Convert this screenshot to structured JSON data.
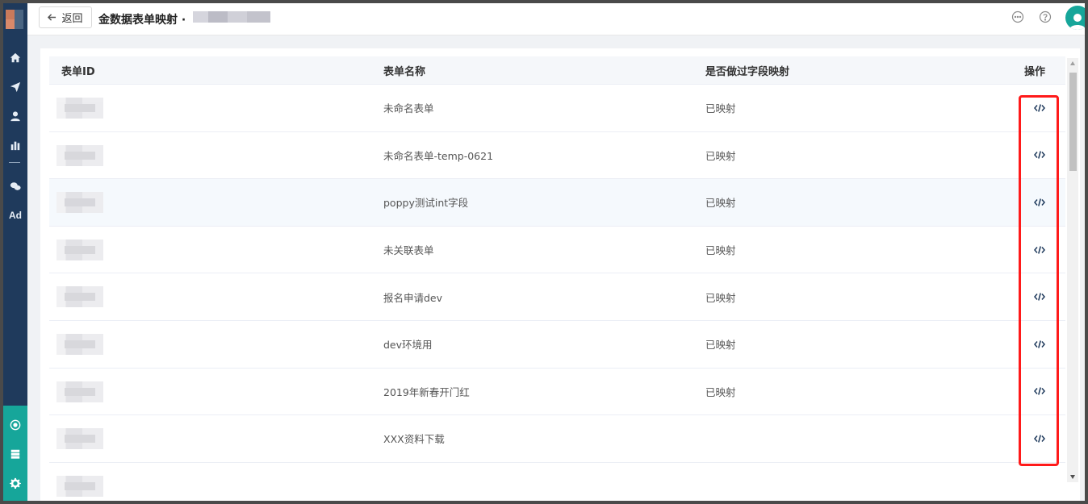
{
  "header": {
    "back_label": "返回",
    "title": "金数据表单映射 ·"
  },
  "table": {
    "columns": [
      "表单ID",
      "表单名称",
      "是否做过字段映射",
      "操作"
    ],
    "rows": [
      {
        "name": "未命名表单",
        "mapped": "已映射"
      },
      {
        "name": "未命名表单-temp-0621",
        "mapped": "已映射"
      },
      {
        "name": "poppy测试int字段",
        "mapped": "已映射"
      },
      {
        "name": "未关联表单",
        "mapped": "已映射"
      },
      {
        "name": "报名申请dev",
        "mapped": "已映射"
      },
      {
        "name": "dev环境用",
        "mapped": "已映射"
      },
      {
        "name": "2019年新春开门红",
        "mapped": "已映射"
      },
      {
        "name": "XXX资料下载",
        "mapped": ""
      }
    ]
  },
  "sidebar": {
    "ad_label": "Ad"
  },
  "colors": {
    "sidebar": "#1f3a5c",
    "accent": "#16a69a",
    "highlight": "#ff1a1a"
  },
  "icons": [
    "home-icon",
    "send-icon",
    "user-icon",
    "bar-chart-icon",
    "wechat-icon",
    "ad-icon",
    "radar-icon",
    "server-icon",
    "gear-icon",
    "message-icon",
    "help-icon",
    "code-icon"
  ]
}
